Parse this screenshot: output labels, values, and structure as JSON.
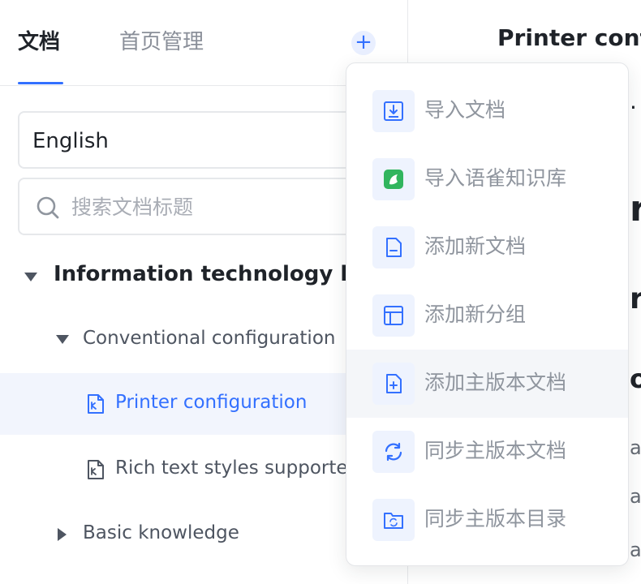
{
  "tabs": [
    {
      "label": "文档",
      "active": true
    },
    {
      "label": "首页管理",
      "active": false
    }
  ],
  "language_select": {
    "value": "English"
  },
  "search": {
    "placeholder": "搜索文档标题",
    "value": ""
  },
  "tree": {
    "root": {
      "label": "Information technology line",
      "expanded": true
    },
    "group1": {
      "label": "Conventional configuration",
      "expanded": true
    },
    "doc_selected": {
      "label": "Printer configuration",
      "icon": "document-icon"
    },
    "doc2": {
      "label": "Rich text styles supporte",
      "icon": "document-icon"
    },
    "group2": {
      "label": "Basic knowledge",
      "expanded": false
    }
  },
  "doc": {
    "title": "Printer conf",
    "fragments": [
      "·",
      "r",
      "ri",
      "o",
      "a",
      "al",
      "al"
    ]
  },
  "add_menu": {
    "items": [
      {
        "label": "导入文档",
        "icon": "import-doc-icon"
      },
      {
        "label": "导入语雀知识库",
        "icon": "yuque-icon"
      },
      {
        "label": "添加新文档",
        "icon": "new-doc-icon"
      },
      {
        "label": "添加新分组",
        "icon": "new-group-icon"
      },
      {
        "label": "添加主版本文档",
        "icon": "add-master-doc-icon"
      },
      {
        "label": "同步主版本文档",
        "icon": "sync-icon"
      },
      {
        "label": "同步主版本目录",
        "icon": "sync-folder-icon"
      }
    ],
    "hovered_index": 4
  },
  "colors": {
    "accent": "#3370ff",
    "text": "#1f2329",
    "muted": "#8f959e",
    "yuque_green": "#31b55e"
  }
}
